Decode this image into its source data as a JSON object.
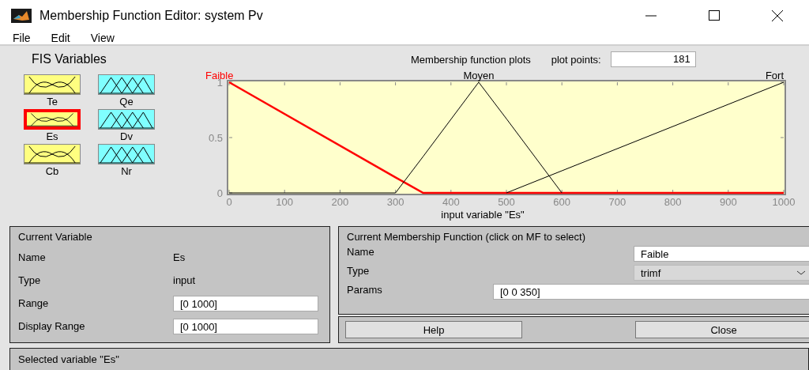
{
  "window": {
    "title": "Membership Function Editor: system Pv"
  },
  "menu": [
    "File",
    "Edit",
    "View"
  ],
  "fis_variables": {
    "title": "FIS Variables",
    "items": [
      {
        "name": "Te",
        "kind": "input",
        "selected": false
      },
      {
        "name": "Qe",
        "kind": "output",
        "selected": false
      },
      {
        "name": "Es",
        "kind": "input",
        "selected": true
      },
      {
        "name": "Dv",
        "kind": "output",
        "selected": false
      },
      {
        "name": "Cb",
        "kind": "input",
        "selected": false
      },
      {
        "name": "Nr",
        "kind": "output",
        "selected": false
      }
    ]
  },
  "plot": {
    "plot_points_label": "plot points:",
    "plot_points": "181",
    "chart_data": {
      "type": "line",
      "title": "Membership function plots",
      "xlabel": "input variable \"Es\"",
      "x": [
        0,
        300,
        350,
        450,
        500,
        600,
        1000
      ],
      "series": [
        {
          "name": "Faible",
          "color": "#ff0000",
          "values": [
            1,
            0.14,
            0,
            0,
            0,
            0,
            0
          ]
        },
        {
          "name": "Moyen",
          "color": "#000000",
          "values": [
            0,
            0,
            0.33,
            1,
            0.67,
            0,
            null
          ]
        },
        {
          "name": "Fort",
          "color": "#000000",
          "values": [
            null,
            null,
            null,
            null,
            0,
            0.2,
            1
          ]
        }
      ],
      "xlim": [
        0,
        1000
      ],
      "ylim": [
        0,
        1
      ],
      "xticks": [
        0,
        100,
        200,
        300,
        400,
        500,
        600,
        700,
        800,
        900,
        1000
      ],
      "yticks": [
        0,
        0.5,
        1
      ]
    }
  },
  "current_variable": {
    "title": "Current Variable",
    "rows": [
      {
        "label": "Name",
        "value": "Es",
        "kind": "text"
      },
      {
        "label": "Type",
        "value": "input",
        "kind": "text"
      },
      {
        "label": "Range",
        "value": "[0 1000]",
        "kind": "field"
      },
      {
        "label": "Display Range",
        "value": "[0 1000]",
        "kind": "field"
      }
    ]
  },
  "current_mf": {
    "title": "Current Membership Function (click on MF to select)",
    "name_label": "Name",
    "name": "Faible",
    "type_label": "Type",
    "type": "trimf",
    "params_label": "Params",
    "params": "[0 0 350]"
  },
  "buttons": [
    "Help",
    "Close"
  ],
  "status_bar": "Selected variable \"Es\""
}
